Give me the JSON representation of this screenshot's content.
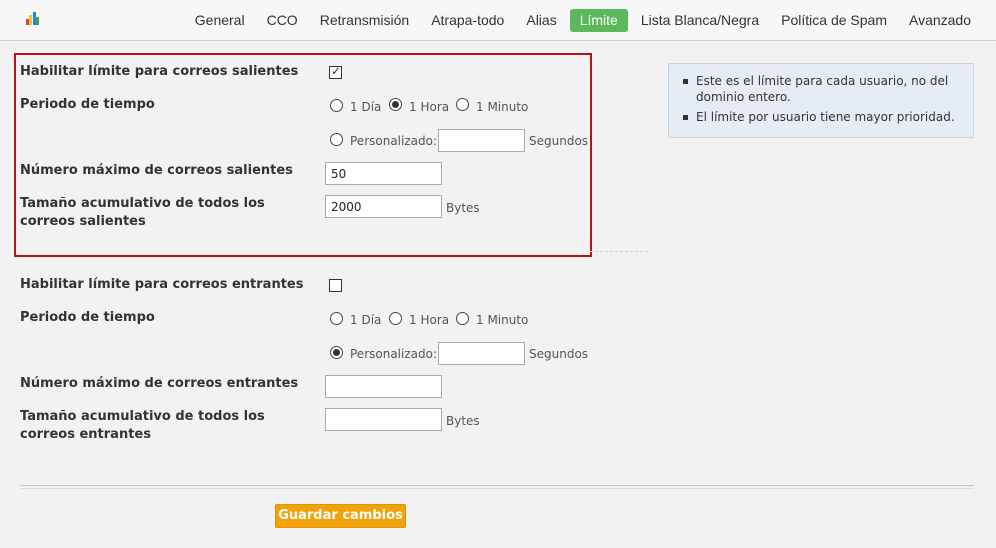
{
  "nav": {
    "logo_colors": [
      "#e53935",
      "#fbc02d",
      "#1e88e5",
      "#43a047"
    ],
    "tabs": [
      {
        "label": "General"
      },
      {
        "label": "CCO"
      },
      {
        "label": "Retransmisión"
      },
      {
        "label": "Atrapa-todo"
      },
      {
        "label": "Alias"
      },
      {
        "label": "Límite",
        "active": true
      },
      {
        "label": "Lista Blanca/Negra"
      },
      {
        "label": "Política de Spam"
      },
      {
        "label": "Avanzado"
      }
    ],
    "active_color": "#5cb85c"
  },
  "outgoing": {
    "enable_label": "Habilitar límite para correos salientes",
    "enabled": true,
    "period_label": "Periodo de tiempo",
    "period_options": {
      "day": "1 Día",
      "hour": "1 Hora",
      "minute": "1 Minuto",
      "custom": "Personalizado:"
    },
    "selected_period": "1 Hora",
    "custom_value": "",
    "seconds_unit": "Segundos",
    "max_count_label": "Número máximo de correos salientes",
    "max_count_value": "50",
    "size_label": "Tamaño acumulativo de todos los correos salientes",
    "size_value": "2000",
    "bytes_unit": "Bytes",
    "highlight_color": "#b5121b"
  },
  "incoming": {
    "enable_label": "Habilitar límite para correos entrantes",
    "enabled": false,
    "period_label": "Periodo de tiempo",
    "period_options": {
      "day": "1 Día",
      "hour": "1 Hora",
      "minute": "1 Minuto",
      "custom": "Personalizado:"
    },
    "selected_period": "Personalizado:",
    "custom_value": "",
    "seconds_unit": "Segundos",
    "max_count_label": "Número máximo de correos entrantes",
    "max_count_value": "",
    "size_label": "Tamaño acumulativo de todos los correos entrantes",
    "size_value": "",
    "bytes_unit": "Bytes"
  },
  "info": {
    "items": [
      "Este es el límite para cada usuario, no del dominio entero.",
      "El límite por usuario tiene mayor prioridad."
    ]
  },
  "save_button": {
    "label": "Guardar cambios",
    "color": "#f0a30a"
  }
}
